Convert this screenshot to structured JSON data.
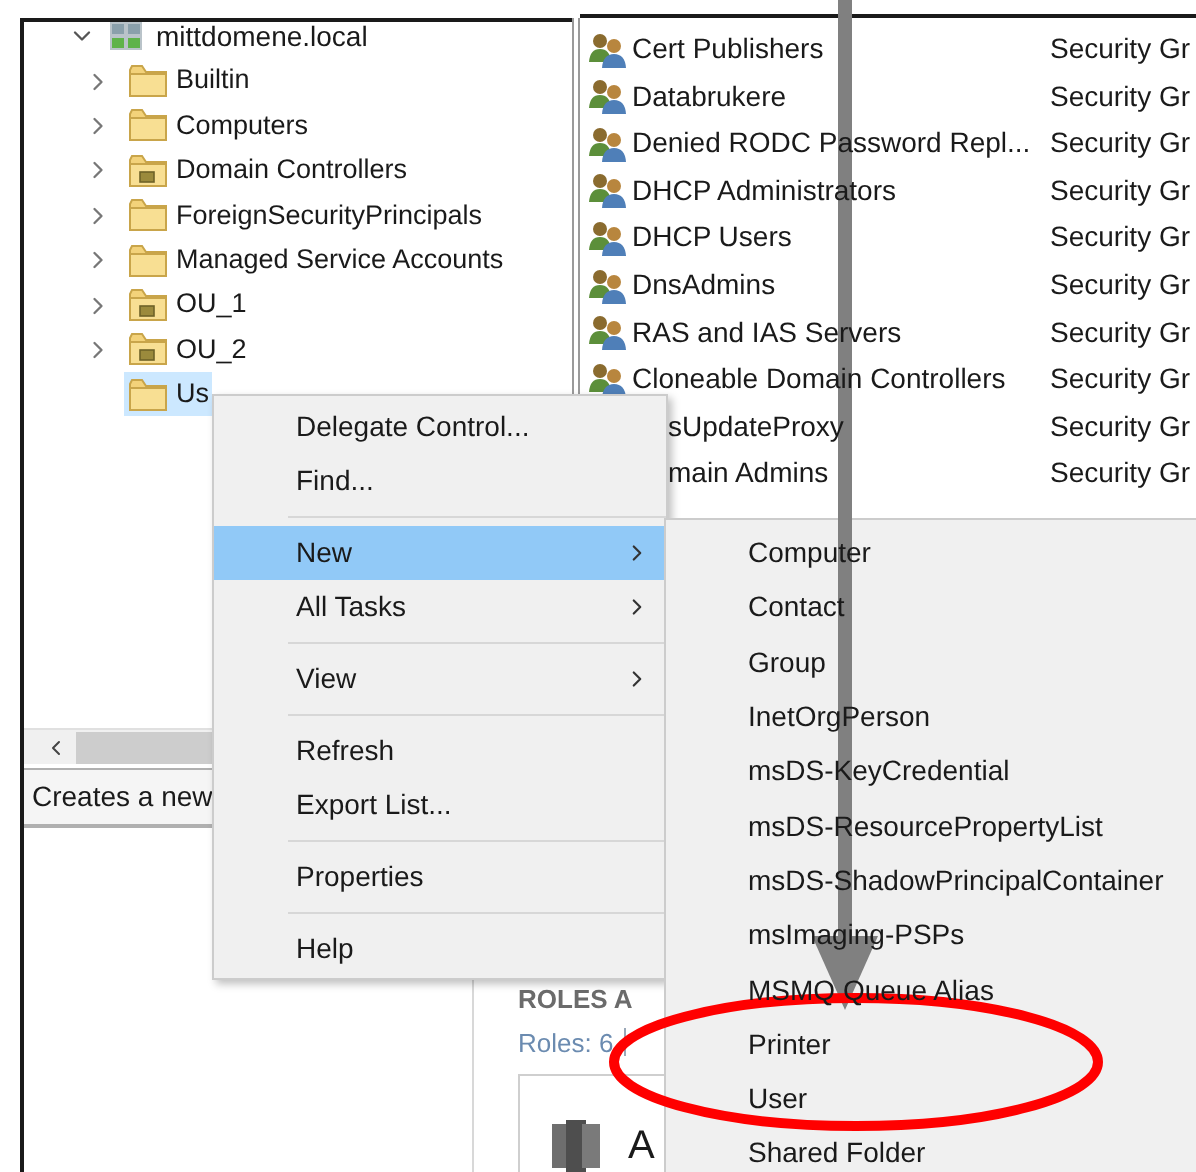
{
  "tree": {
    "root": {
      "label": "mittdomene.local",
      "expanded": true
    },
    "children": [
      {
        "label": "Builtin",
        "kind": "folder",
        "expandable": true,
        "selected": false
      },
      {
        "label": "Computers",
        "kind": "folder",
        "expandable": true,
        "selected": false
      },
      {
        "label": "Domain Controllers",
        "kind": "ou",
        "expandable": true,
        "selected": false
      },
      {
        "label": "ForeignSecurityPrincipals",
        "kind": "folder",
        "expandable": true,
        "selected": false
      },
      {
        "label": "Managed Service Accounts",
        "kind": "folder",
        "expandable": true,
        "selected": false
      },
      {
        "label": "OU_1",
        "kind": "ou",
        "expandable": true,
        "selected": false
      },
      {
        "label": "OU_2",
        "kind": "ou",
        "expandable": true,
        "selected": false
      },
      {
        "label": "Us",
        "kind": "folder",
        "expandable": false,
        "selected": true
      }
    ]
  },
  "list": {
    "rows": [
      {
        "name": "Cert Publishers",
        "type": "Security Gr",
        "kind": "group"
      },
      {
        "name": "Databrukere",
        "type": "Security Gr",
        "kind": "group"
      },
      {
        "name": "Denied RODC Password Repl...",
        "type": "Security Gr",
        "kind": "group"
      },
      {
        "name": "DHCP Administrators",
        "type": "Security Gr",
        "kind": "group"
      },
      {
        "name": "DHCP Users",
        "type": "Security Gr",
        "kind": "group"
      },
      {
        "name": "DnsAdmins",
        "type": "Security Gr",
        "kind": "group"
      },
      {
        "name": "RAS and IAS Servers",
        "type": "Security Gr",
        "kind": "group"
      },
      {
        "name": "Cloneable Domain Controllers",
        "type": "Security Gr",
        "kind": "group"
      },
      {
        "name": "sUpdateProxy",
        "type": "Security Gr",
        "kind": "covered"
      },
      {
        "name": "main Admins",
        "type": "Security Gr",
        "kind": "covered"
      }
    ]
  },
  "status_bar": "Creates a new",
  "context_menu": {
    "sections": [
      [
        {
          "label": "Delegate Control...",
          "submenu": false,
          "selected": false
        },
        {
          "label": "Find...",
          "submenu": false,
          "selected": false
        }
      ],
      [
        {
          "label": "New",
          "submenu": true,
          "selected": true
        },
        {
          "label": "All Tasks",
          "submenu": true,
          "selected": false
        }
      ],
      [
        {
          "label": "View",
          "submenu": true,
          "selected": false
        }
      ],
      [
        {
          "label": "Refresh",
          "submenu": false,
          "selected": false
        },
        {
          "label": "Export List...",
          "submenu": false,
          "selected": false
        }
      ],
      [
        {
          "label": "Properties",
          "submenu": false,
          "selected": false
        }
      ],
      [
        {
          "label": "Help",
          "submenu": false,
          "selected": false
        }
      ]
    ]
  },
  "submenu": {
    "items": [
      "Computer",
      "Contact",
      "Group",
      "InetOrgPerson",
      "msDS-KeyCredential",
      "msDS-ResourcePropertyList",
      "msDS-ShadowPrincipalContainer",
      "msImaging-PSPs",
      "MSMQ Queue Alias",
      "Printer",
      "User",
      "Shared Folder"
    ]
  },
  "background_window": {
    "heading": "ROLES A",
    "roles": "Roles: 6",
    "card_label": "A"
  }
}
